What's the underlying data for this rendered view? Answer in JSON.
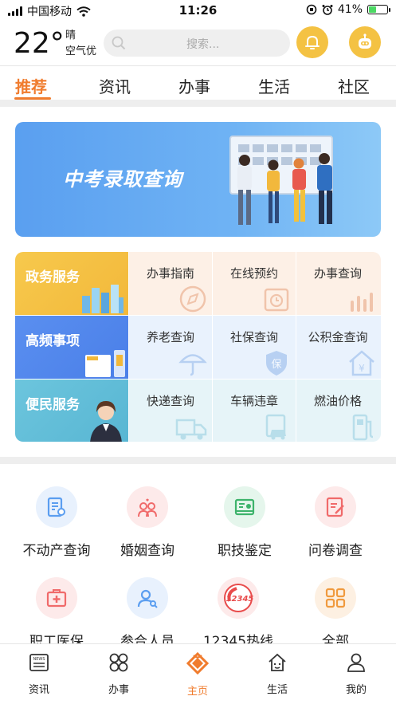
{
  "status_bar": {
    "carrier": "中国移动",
    "time": "11:26",
    "battery": "41%",
    "battery_level": 0.41
  },
  "header": {
    "temperature": "22°",
    "weather": "晴",
    "air_quality": "空气优",
    "search_placeholder": "搜索..."
  },
  "tabs": [
    {
      "label": "推荐",
      "active": true
    },
    {
      "label": "资讯"
    },
    {
      "label": "办事"
    },
    {
      "label": "生活"
    },
    {
      "label": "社区"
    }
  ],
  "banner": {
    "title": "中考录取查询"
  },
  "service_grid": {
    "rows": [
      {
        "category": "政务服务",
        "items": [
          "办事指南",
          "在线预约",
          "办事查询"
        ]
      },
      {
        "category": "高频事项",
        "items": [
          "养老查询",
          "社保查询",
          "公积金查询"
        ]
      },
      {
        "category": "便民服务",
        "items": [
          "快递查询",
          "车辆违章",
          "燃油价格"
        ]
      }
    ]
  },
  "quick_icons": [
    {
      "label": "不动产查询",
      "icon": "property-icon",
      "color": "#5b9ef0"
    },
    {
      "label": "婚姻查询",
      "icon": "marriage-icon",
      "color": "#f06a6a"
    },
    {
      "label": "职技鉴定",
      "icon": "certificate-icon",
      "color": "#3db36b"
    },
    {
      "label": "问卷调查",
      "icon": "survey-icon",
      "color": "#f06a6a"
    },
    {
      "label": "职工医保",
      "icon": "medical-icon",
      "color": "#f06a6a"
    },
    {
      "label": "参合人员",
      "icon": "person-search-icon",
      "color": "#5b9ef0"
    },
    {
      "label": "12345热线",
      "icon": "hotline-icon",
      "color": "#e84b4b"
    },
    {
      "label": "全部",
      "icon": "grid-icon",
      "color": "#f09a3e"
    }
  ],
  "bottom_nav": [
    {
      "label": "资讯",
      "icon": "news-icon"
    },
    {
      "label": "办事",
      "icon": "apps-icon"
    },
    {
      "label": "主页",
      "icon": "home-logo-icon",
      "active": true
    },
    {
      "label": "生活",
      "icon": "house-icon"
    },
    {
      "label": "我的",
      "icon": "user-icon"
    }
  ],
  "colors": {
    "accent": "#f07c2e",
    "yellow": "#f4c243"
  }
}
